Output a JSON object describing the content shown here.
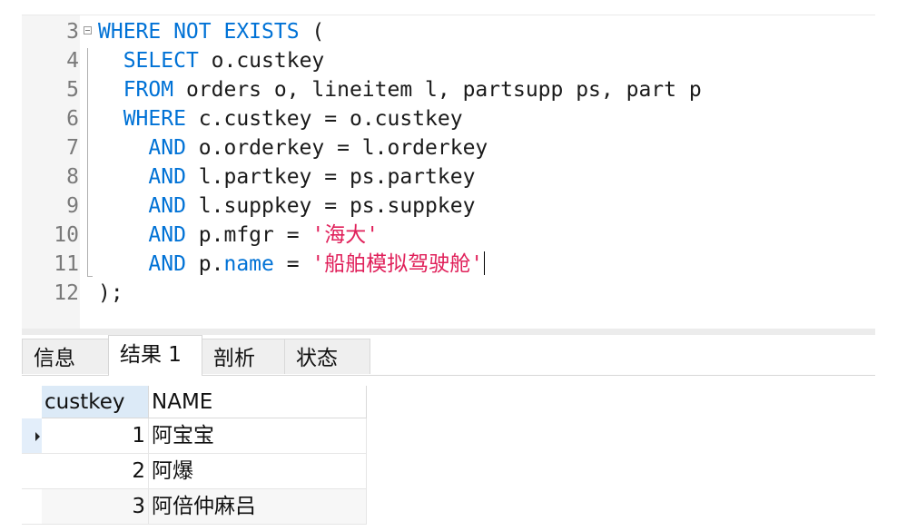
{
  "editor": {
    "lines": [
      {
        "num": "3",
        "tokens": [
          {
            "t": "WHERE NOT EXISTS",
            "c": "kw"
          },
          {
            "t": " (",
            "c": ""
          }
        ]
      },
      {
        "num": "4",
        "tokens": [
          {
            "t": "  ",
            "c": ""
          },
          {
            "t": "SELECT",
            "c": "kw"
          },
          {
            "t": " o.custkey",
            "c": ""
          }
        ]
      },
      {
        "num": "5",
        "tokens": [
          {
            "t": "  ",
            "c": ""
          },
          {
            "t": "FROM",
            "c": "kw"
          },
          {
            "t": " orders o, lineitem l, partsupp ps, part p",
            "c": ""
          }
        ]
      },
      {
        "num": "6",
        "tokens": [
          {
            "t": "  ",
            "c": ""
          },
          {
            "t": "WHERE",
            "c": "kw"
          },
          {
            "t": " c.custkey = o.custkey",
            "c": ""
          }
        ]
      },
      {
        "num": "7",
        "tokens": [
          {
            "t": "    ",
            "c": ""
          },
          {
            "t": "AND",
            "c": "kw"
          },
          {
            "t": " o.orderkey = l.orderkey",
            "c": ""
          }
        ]
      },
      {
        "num": "8",
        "tokens": [
          {
            "t": "    ",
            "c": ""
          },
          {
            "t": "AND",
            "c": "kw"
          },
          {
            "t": " l.partkey = ps.partkey",
            "c": ""
          }
        ]
      },
      {
        "num": "9",
        "tokens": [
          {
            "t": "    ",
            "c": ""
          },
          {
            "t": "AND",
            "c": "kw"
          },
          {
            "t": " l.suppkey = ps.suppkey",
            "c": ""
          }
        ]
      },
      {
        "num": "10",
        "tokens": [
          {
            "t": "    ",
            "c": ""
          },
          {
            "t": "AND",
            "c": "kw"
          },
          {
            "t": " p.mfgr = ",
            "c": ""
          },
          {
            "t": "'海大'",
            "c": "str"
          }
        ]
      },
      {
        "num": "11",
        "tokens": [
          {
            "t": "    ",
            "c": ""
          },
          {
            "t": "AND",
            "c": "kw"
          },
          {
            "t": " p.",
            "c": ""
          },
          {
            "t": "name",
            "c": "fn"
          },
          {
            "t": " = ",
            "c": ""
          },
          {
            "t": "'船舶模拟驾驶舱'",
            "c": "str"
          }
        ]
      },
      {
        "num": "12",
        "tokens": [
          {
            "t": ");",
            "c": ""
          }
        ]
      }
    ]
  },
  "tabs": [
    {
      "label": "信息",
      "active": false
    },
    {
      "label": "结果 1",
      "active": true
    },
    {
      "label": "剖析",
      "active": false
    },
    {
      "label": "状态",
      "active": false
    }
  ],
  "grid": {
    "columns": [
      "custkey",
      "NAME"
    ],
    "rows": [
      {
        "custkey": "1",
        "name": "阿宝宝"
      },
      {
        "custkey": "2",
        "name": "阿爆"
      },
      {
        "custkey": "3",
        "name": "阿倍仲麻吕"
      }
    ]
  },
  "colors": {
    "keyword": "#0072d6",
    "string": "#e0205a",
    "header_selected": "#dceaf7"
  }
}
